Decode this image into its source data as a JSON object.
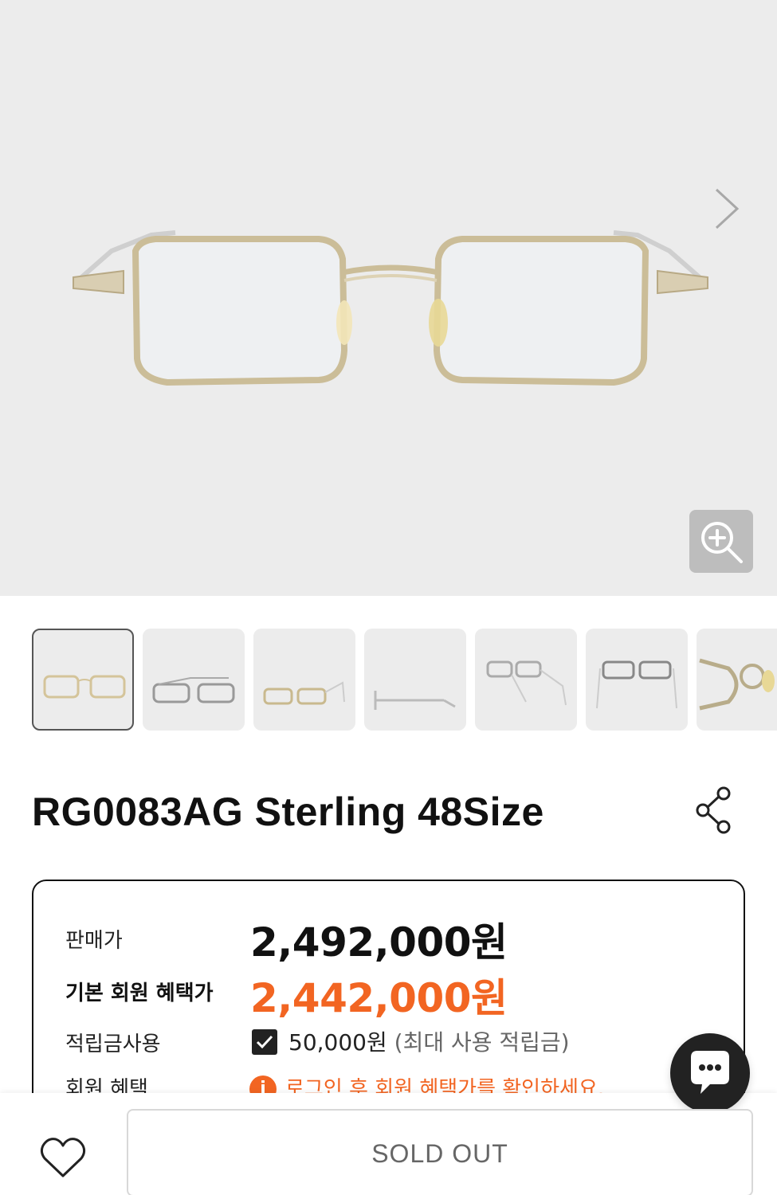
{
  "product": {
    "title": "RG0083AG Sterling 48Size"
  },
  "pricing": {
    "sale_label": "판매가",
    "sale_price": "2,492,000원",
    "member_label": "기본 회원 혜택가",
    "member_price": "2,442,000원",
    "points_label": "적립금사용",
    "points_value": "50,000원",
    "points_note": "(최대 사용 적립금)",
    "benefit_label": "회원 혜택",
    "benefit_note": "로그인 후 회원 혜택가를 확인하세요."
  },
  "actions": {
    "sold_out_label": "SOLD OUT"
  },
  "icons": {
    "next": "chevron-right-icon",
    "zoom": "zoom-in-icon",
    "share": "share-icon",
    "chat": "chat-icon",
    "wishlist": "heart-icon",
    "info": "info-icon"
  },
  "colors": {
    "accent": "#f26522",
    "hero_bg": "#ececec",
    "text": "#111111"
  },
  "gallery": {
    "thumbnail_count": 7,
    "active_index": 0
  }
}
